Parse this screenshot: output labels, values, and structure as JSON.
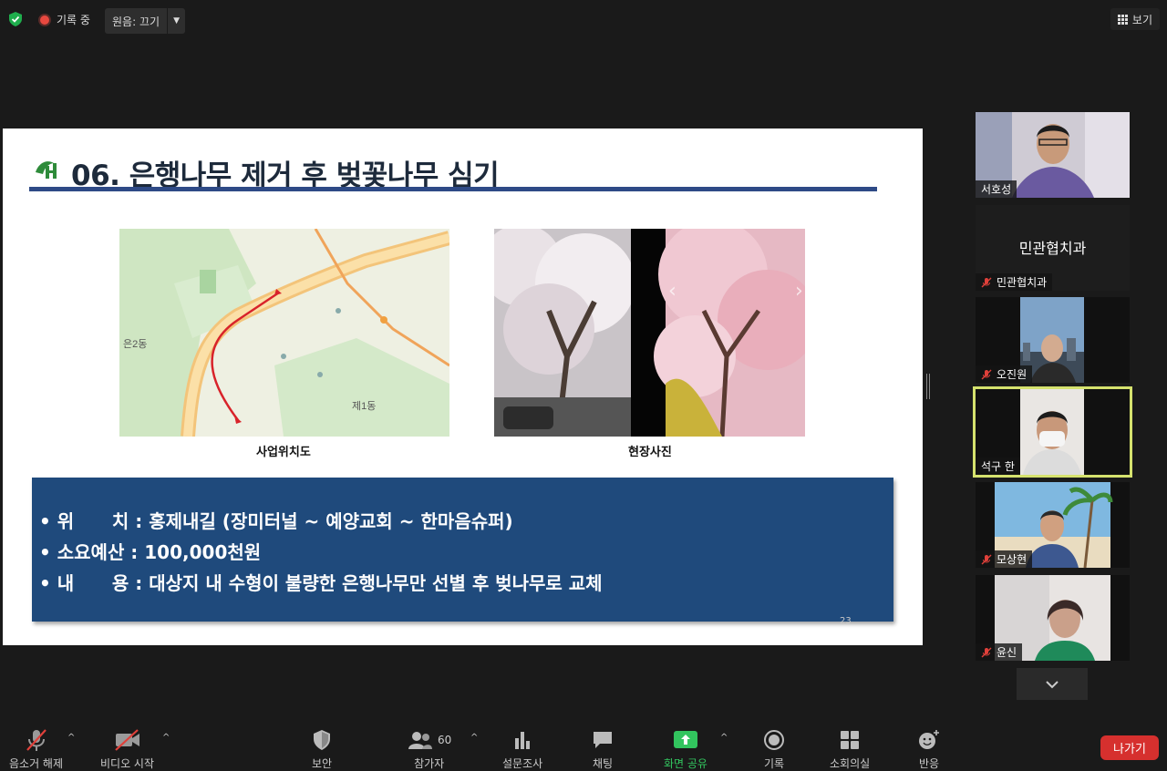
{
  "top": {
    "recording": "기록 중",
    "original_sound": "원음: 끄기",
    "view": "보기"
  },
  "slide": {
    "title": "06. 은행나무 제거 후 벚꽃나무 심기",
    "caption_map": "사업위치도",
    "caption_photo": "현장사진",
    "map_labels": [
      "은2동",
      "제1동"
    ],
    "info_lines": [
      "• 위      치 : 홍제내길 (장미터널 ~ 예양교회 ~ 한마음슈퍼)",
      "• 소요예산 : 100,000천원",
      "• 내      용 : 대상지 내 수형이 불량한 은행나무만 선별 후 벚나무로 교체"
    ],
    "page_number": "23"
  },
  "participants": [
    {
      "name": "서호성",
      "muted": false
    },
    {
      "name": "민관협치과",
      "muted": true,
      "title": "민관협치과"
    },
    {
      "name": "오진원",
      "muted": true
    },
    {
      "name": "석구 한",
      "muted": false,
      "active": true
    },
    {
      "name": "모상현",
      "muted": true
    },
    {
      "name": "윤신",
      "muted": true
    }
  ],
  "toolbar": {
    "unmute": "음소거 해제",
    "start_video": "비디오 시작",
    "security": "보안",
    "participants": "참가자",
    "participant_count": "60",
    "polls": "설문조사",
    "chat": "채팅",
    "share": "화면 공유",
    "record": "기록",
    "breakout": "소회의실",
    "reactions": "반응",
    "leave": "나가기"
  },
  "colors": {
    "share_green": "#32c45e",
    "leave_red": "#d6302e",
    "active_speaker": "#d5e26e",
    "info_box": "#1f4a7c"
  }
}
